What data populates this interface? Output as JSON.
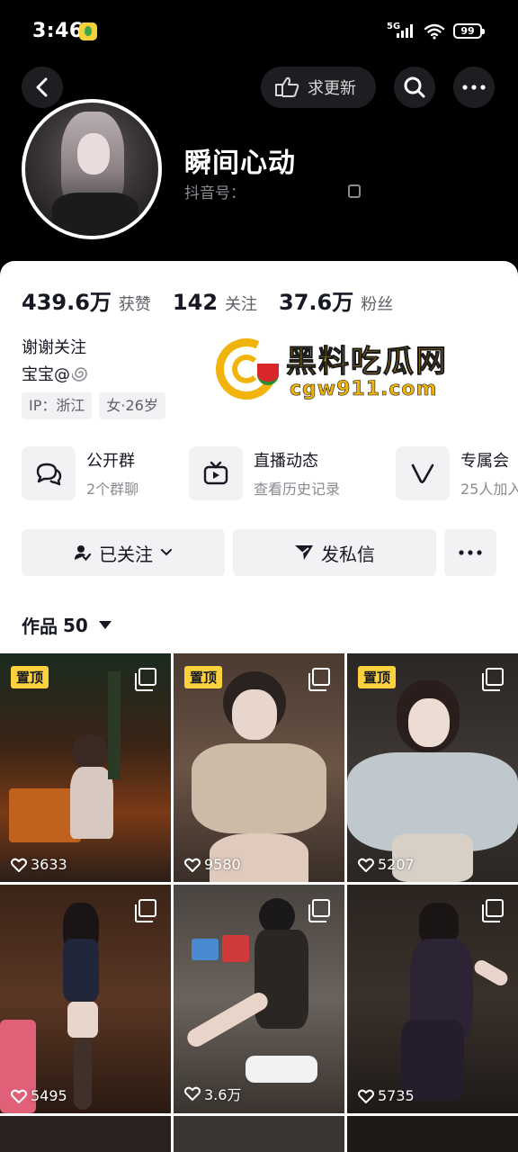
{
  "status_bar": {
    "time": "3:46",
    "network": "5G",
    "battery": "99",
    "icons": [
      "app-notification-icon",
      "signal-icon",
      "wifi-icon",
      "battery-icon"
    ]
  },
  "header": {
    "update_label": "求更新",
    "nickname": "瞬间心动",
    "douyin_id_label": "抖音号："
  },
  "stats": [
    {
      "value": "439.6万",
      "label": "获赞"
    },
    {
      "value": "142",
      "label": "关注"
    },
    {
      "value": "37.6万",
      "label": "粉丝"
    }
  ],
  "bio": {
    "line1": "谢谢关注",
    "line2": "宝宝@"
  },
  "tags": [
    "IP：浙江",
    "女·26岁"
  ],
  "watermark": {
    "title": "黑料吃瓜网",
    "url": "cgw911.com"
  },
  "cards": [
    {
      "title": "公开群",
      "subtitle": "2个群聊",
      "icon": "group-chat-icon"
    },
    {
      "title": "直播动态",
      "subtitle": "查看历史记录",
      "icon": "live-tv-icon"
    },
    {
      "title": "专属会",
      "subtitle": "25人加入",
      "icon": "vip-v-icon"
    }
  ],
  "actions": {
    "followed_label": "已关注",
    "message_label": "发私信"
  },
  "works": {
    "label": "作品",
    "count": "50"
  },
  "grid": [
    {
      "pinned": true,
      "pin_label": "置顶",
      "likes": "3633"
    },
    {
      "pinned": true,
      "pin_label": "置顶",
      "likes": "9580"
    },
    {
      "pinned": true,
      "pin_label": "置顶",
      "likes": "5207"
    },
    {
      "pinned": false,
      "pin_label": "",
      "likes": "5495"
    },
    {
      "pinned": false,
      "pin_label": "",
      "likes": "3.6万"
    },
    {
      "pinned": false,
      "pin_label": "",
      "likes": "5735"
    }
  ],
  "colors": {
    "header_bg": "#000000",
    "sheet_bg": "#ffffff",
    "pin_badge": "#fbd23e",
    "watermark": "#f0b40c"
  }
}
